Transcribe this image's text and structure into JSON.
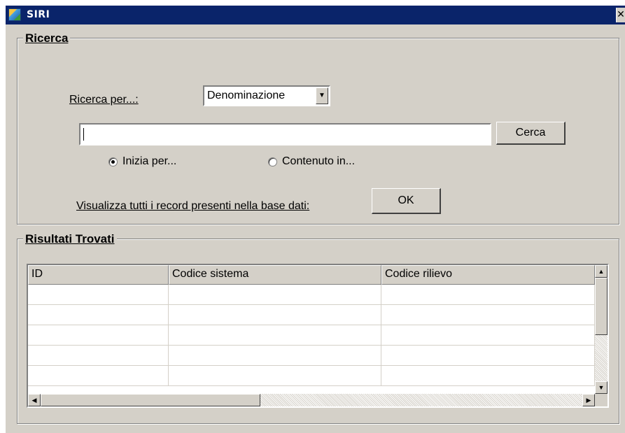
{
  "window": {
    "title": "SIRI",
    "close_glyph": "✕"
  },
  "search_group": {
    "title": "Ricerca",
    "search_by_label": "Ricerca per...:",
    "search_by_value": "Denominazione",
    "search_input_value": "",
    "search_button_label": "Cerca",
    "radio_starts_with": {
      "label": "Inizia per...",
      "checked": true
    },
    "radio_contains": {
      "label": "Contenuto in...",
      "checked": false
    },
    "show_all_label": "Visualizza tutti i record presenti nella base dati:",
    "ok_button_label": "OK"
  },
  "results_group": {
    "title": "Risultati Trovati",
    "columns": [
      "ID",
      "Codice sistema",
      "Codice rilievo"
    ],
    "rows": [
      [
        "",
        "",
        ""
      ],
      [
        "",
        "",
        ""
      ],
      [
        "",
        "",
        ""
      ],
      [
        "",
        "",
        ""
      ],
      [
        "",
        "",
        ""
      ]
    ]
  },
  "icons": {
    "app": "siri-app-icon",
    "close": "close-icon",
    "dropdown": "chevron-down-icon",
    "scroll_up": "arrow-up-icon",
    "scroll_down": "arrow-down-icon",
    "scroll_left": "arrow-left-icon",
    "scroll_right": "arrow-right-icon"
  },
  "colors": {
    "titlebar": "#0a246a",
    "face": "#d4d0c8",
    "field": "#ffffff"
  }
}
